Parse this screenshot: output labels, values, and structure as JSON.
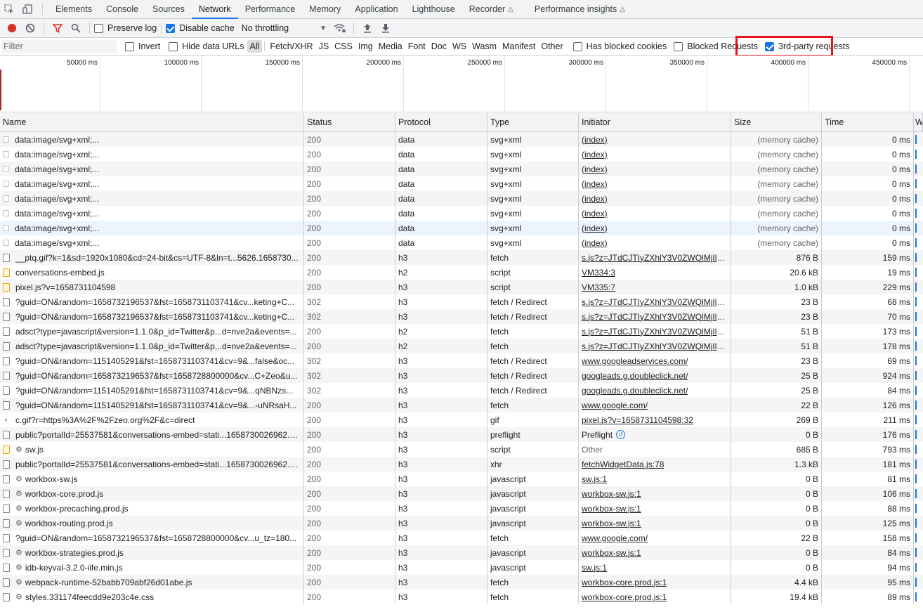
{
  "tabs": [
    "Elements",
    "Console",
    "Sources",
    "Network",
    "Performance",
    "Memory",
    "Application",
    "Lighthouse",
    "Recorder",
    "Performance insights"
  ],
  "toolbar": {
    "preserve_log": "Preserve log",
    "disable_cache": "Disable cache",
    "throttling": "No throttling"
  },
  "filterbar": {
    "placeholder": "Filter",
    "invert": "Invert",
    "hide_data_urls": "Hide data URLs",
    "types": [
      "All",
      "Fetch/XHR",
      "JS",
      "CSS",
      "Img",
      "Media",
      "Font",
      "Doc",
      "WS",
      "Wasm",
      "Manifest",
      "Other"
    ],
    "has_blocked_cookies": "Has blocked cookies",
    "blocked_requests": "Blocked Requests",
    "third_party": "3rd-party requests"
  },
  "overview": {
    "ticks": [
      "50000 ms",
      "100000 ms",
      "150000 ms",
      "200000 ms",
      "250000 ms",
      "300000 ms",
      "350000 ms",
      "400000 ms",
      "450000 ms"
    ]
  },
  "columns": [
    "Name",
    "Status",
    "Protocol",
    "Type",
    "Initiator",
    "Size",
    "Time",
    "W"
  ],
  "rows": [
    {
      "name": "data:image/svg+xml;...",
      "status": "200",
      "protocol": "data",
      "type": "svg+xml",
      "initiator": "(index)",
      "size": "(memory cache)",
      "time": "0 ms"
    },
    {
      "name": "data:image/svg+xml;...",
      "status": "200",
      "protocol": "data",
      "type": "svg+xml",
      "initiator": "(index)",
      "size": "(memory cache)",
      "time": "0 ms"
    },
    {
      "name": "data:image/svg+xml;...",
      "status": "200",
      "protocol": "data",
      "type": "svg+xml",
      "initiator": "(index)",
      "size": "(memory cache)",
      "time": "0 ms"
    },
    {
      "name": "data:image/svg+xml;...",
      "status": "200",
      "protocol": "data",
      "type": "svg+xml",
      "initiator": "(index)",
      "size": "(memory cache)",
      "time": "0 ms"
    },
    {
      "name": "data:image/svg+xml;...",
      "status": "200",
      "protocol": "data",
      "type": "svg+xml",
      "initiator": "(index)",
      "size": "(memory cache)",
      "time": "0 ms"
    },
    {
      "name": "data:image/svg+xml;...",
      "status": "200",
      "protocol": "data",
      "type": "svg+xml",
      "initiator": "(index)",
      "size": "(memory cache)",
      "time": "0 ms"
    },
    {
      "name": "data:image/svg+xml;...",
      "status": "200",
      "protocol": "data",
      "type": "svg+xml",
      "initiator": "(index)",
      "size": "(memory cache)",
      "time": "0 ms"
    },
    {
      "name": "data:image/svg+xml;...",
      "status": "200",
      "protocol": "data",
      "type": "svg+xml",
      "initiator": "(index)",
      "size": "(memory cache)",
      "time": "0 ms"
    },
    {
      "name": "__ptq.gif?k=1&sd=1920x1080&cd=24-bit&cs=UTF-8&ln=t...5626.1658730...",
      "status": "200",
      "protocol": "h3",
      "type": "fetch",
      "initiator": "s.js?z=JTdCJTIyZXhlY3V0ZWQlMjIlM0...",
      "size": "876 B",
      "time": "159 ms"
    },
    {
      "name": "conversations-embed.js",
      "status": "200",
      "protocol": "h2",
      "type": "script",
      "initiator": "VM334:3",
      "size": "20.6 kB",
      "time": "19 ms"
    },
    {
      "name": "pixel.js?v=1658731104598",
      "status": "200",
      "protocol": "h3",
      "type": "script",
      "initiator": "VM335:7",
      "size": "1.0 kB",
      "time": "229 ms"
    },
    {
      "name": "?guid=ON&random=1658732196537&fst=1658731103741&cv...keting+C...",
      "status": "302",
      "protocol": "h3",
      "type": "fetch / Redirect",
      "initiator": "s.js?z=JTdCJTIyZXhlY3V0ZWQlMjIlM0...",
      "size": "23 B",
      "time": "68 ms"
    },
    {
      "name": "?guid=ON&random=1658732196537&fst=1658731103741&cv...keting+C...",
      "status": "302",
      "protocol": "h3",
      "type": "fetch / Redirect",
      "initiator": "s.js?z=JTdCJTIyZXhlY3V0ZWQlMjIlM0...",
      "size": "23 B",
      "time": "70 ms"
    },
    {
      "name": "adsct?type=javascript&version=1.1.0&p_id=Twitter&p...d=nve2a&events=...",
      "status": "200",
      "protocol": "h2",
      "type": "fetch",
      "initiator": "s.js?z=JTdCJTIyZXhlY3V0ZWQlMjIlM0...",
      "size": "51 B",
      "time": "173 ms"
    },
    {
      "name": "adsct?type=javascript&version=1.1.0&p_id=Twitter&p...d=nve2a&events=...",
      "status": "200",
      "protocol": "h2",
      "type": "fetch",
      "initiator": "s.js?z=JTdCJTIyZXhlY3V0ZWQlMjIlM0...",
      "size": "51 B",
      "time": "178 ms"
    },
    {
      "name": "?guid=ON&random=1151405291&fst=1658731103741&cv=9&...false&oc...",
      "status": "302",
      "protocol": "h3",
      "type": "fetch / Redirect",
      "initiator": "www.googleadservices.com/",
      "size": "23 B",
      "time": "69 ms"
    },
    {
      "name": "?guid=ON&random=1658732196537&fst=1658728800000&cv...C+Zeo&u...",
      "status": "302",
      "protocol": "h3",
      "type": "fetch / Redirect",
      "initiator": "googleads.g.doubleclick.net/",
      "size": "25 B",
      "time": "924 ms"
    },
    {
      "name": "?guid=ON&random=1151405291&fst=1658731103741&cv=9&...qNBNzs...",
      "status": "302",
      "protocol": "h3",
      "type": "fetch / Redirect",
      "initiator": "googleads.g.doubleclick.net/",
      "size": "25 B",
      "time": "84 ms"
    },
    {
      "name": "?guid=ON&random=1151405291&fst=1658731103741&cv=9&...-uNRsaH...",
      "status": "200",
      "protocol": "h3",
      "type": "fetch",
      "initiator": "www.google.com/",
      "size": "22 B",
      "time": "126 ms"
    },
    {
      "name": "c.gif?r=https%3A%2F%2Fzeo.org%2F&c=direct",
      "status": "200",
      "protocol": "h3",
      "type": "gif",
      "initiator": "pixel.js?v=1658731104598:32",
      "size": "269 B",
      "time": "211 ms"
    },
    {
      "name": "public?portalId=25537581&conversations-embed=stati...1658730026962.1...",
      "status": "200",
      "protocol": "h3",
      "type": "preflight",
      "initiator": "Preflight",
      "size": "0 B",
      "time": "176 ms"
    },
    {
      "name": "sw.js",
      "status": "200",
      "protocol": "h3",
      "type": "script",
      "initiator": "Other",
      "size": "685 B",
      "time": "793 ms"
    },
    {
      "name": "public?portalId=25537581&conversations-embed=stati...1658730026962.1...",
      "status": "200",
      "protocol": "h3",
      "type": "xhr",
      "initiator": "fetchWidgetData.js:78",
      "size": "1.3 kB",
      "time": "181 ms"
    },
    {
      "name": "workbox-sw.js",
      "status": "200",
      "protocol": "h3",
      "type": "javascript",
      "initiator": "sw.js:1",
      "size": "0 B",
      "time": "81 ms"
    },
    {
      "name": "workbox-core.prod.js",
      "status": "200",
      "protocol": "h3",
      "type": "javascript",
      "initiator": "workbox-sw.js:1",
      "size": "0 B",
      "time": "106 ms"
    },
    {
      "name": "workbox-precaching.prod.js",
      "status": "200",
      "protocol": "h3",
      "type": "javascript",
      "initiator": "workbox-sw.js:1",
      "size": "0 B",
      "time": "88 ms"
    },
    {
      "name": "workbox-routing.prod.js",
      "status": "200",
      "protocol": "h3",
      "type": "javascript",
      "initiator": "workbox-sw.js:1",
      "size": "0 B",
      "time": "125 ms"
    },
    {
      "name": "?guid=ON&random=1658732196537&fst=1658728800000&cv...u_tz=180...",
      "status": "200",
      "protocol": "h3",
      "type": "fetch",
      "initiator": "www.google.com/",
      "size": "22 B",
      "time": "158 ms"
    },
    {
      "name": "workbox-strategies.prod.js",
      "status": "200",
      "protocol": "h3",
      "type": "javascript",
      "initiator": "workbox-sw.js:1",
      "size": "0 B",
      "time": "84 ms"
    },
    {
      "name": "idb-keyval-3.2.0-iife.min.js",
      "status": "200",
      "protocol": "h3",
      "type": "javascript",
      "initiator": "sw.js:1",
      "size": "0 B",
      "time": "94 ms"
    },
    {
      "name": "webpack-runtime-52babb709abf26d01abe.js",
      "status": "200",
      "protocol": "h3",
      "type": "fetch",
      "initiator": "workbox-core.prod.js:1",
      "size": "4.4 kB",
      "time": "95 ms"
    },
    {
      "name": "styles.331174feecdd9e203c4e.css",
      "status": "200",
      "protocol": "h3",
      "type": "fetch",
      "initiator": "workbox-core.prod.js:1",
      "size": "19.4 kB",
      "time": "89 ms"
    }
  ]
}
